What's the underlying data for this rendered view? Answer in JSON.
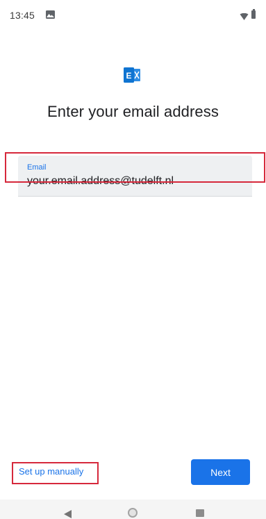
{
  "status_bar": {
    "time": "13:45",
    "icons": [
      "image-icon",
      "wifi-icon",
      "battery-icon"
    ]
  },
  "app": {
    "logo": "exchange-logo-icon",
    "brand_color": "#0f74d1"
  },
  "page": {
    "title": "Enter your email address"
  },
  "email_field": {
    "label": "Email",
    "value": "your.email.address@tudelft.nl"
  },
  "actions": {
    "manual_label": "Set up manually",
    "next_label": "Next"
  },
  "nav_bar": {
    "icons": [
      "back-icon",
      "home-icon",
      "recents-icon"
    ]
  },
  "colors": {
    "accent": "#1a73e8",
    "highlight": "#d6283b",
    "field_background": "#eef0f2"
  }
}
